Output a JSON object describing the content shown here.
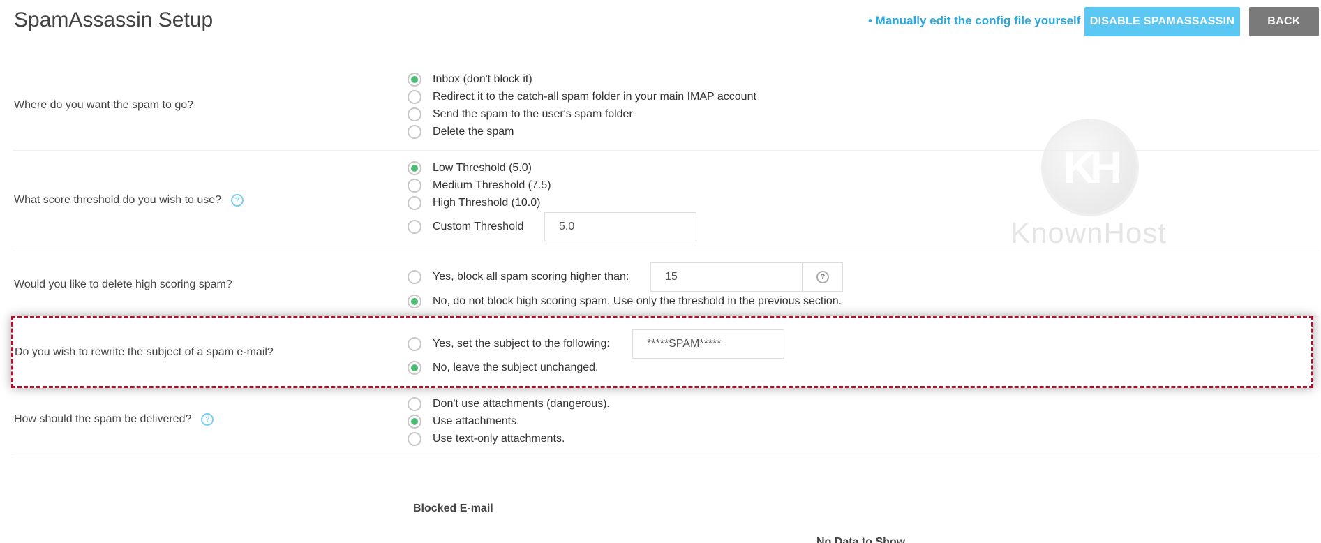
{
  "header": {
    "title": "SpamAssassin Setup",
    "config_link": "• Manually edit the config file yourself",
    "disable_button": "DISABLE SPAMASSASSIN",
    "back_button": "BACK"
  },
  "sections": {
    "destination": {
      "question": "Where do you want the spam to go?",
      "options": [
        "Inbox (don't block it)",
        "Redirect it to the catch-all spam folder in your main IMAP account",
        "Send the spam to the user's spam folder",
        "Delete the spam"
      ],
      "selected": 0
    },
    "threshold": {
      "question": "What score threshold do you wish to use?",
      "help": "?",
      "options": [
        "Low Threshold (5.0)",
        "Medium Threshold (7.5)",
        "High Threshold (10.0)",
        "Custom Threshold"
      ],
      "selected": 0,
      "custom_value": "5.0"
    },
    "high_scoring": {
      "question": "Would you like to delete high scoring spam?",
      "options": [
        "Yes, block all spam scoring higher than:",
        "No, do not block high scoring spam. Use only the threshold in the previous section."
      ],
      "selected": 1,
      "value": "15",
      "help": "?"
    },
    "rewrite_subject": {
      "question": "Do you wish to rewrite the subject of a spam e-mail?",
      "options": [
        "Yes, set the subject to the following:",
        "No, leave the subject unchanged."
      ],
      "selected": 1,
      "value": "*****SPAM*****"
    },
    "delivery": {
      "question": "How should the spam be delivered?",
      "help": "?",
      "options": [
        "Don't use attachments (dangerous).",
        "Use attachments.",
        "Use text-only attachments."
      ],
      "selected": 1
    }
  },
  "blocked_email": {
    "heading": "Blocked E-mail",
    "empty_text": "No Data to Show"
  },
  "watermark": {
    "logo_text": "KH",
    "brand": "KnownHost"
  },
  "colors": {
    "accent": "#5bc8f3",
    "back_button": "#7a7a7a",
    "link": "#2aa8e0",
    "radio_selected": "#4cbd73",
    "highlight_border": "#b01030"
  }
}
